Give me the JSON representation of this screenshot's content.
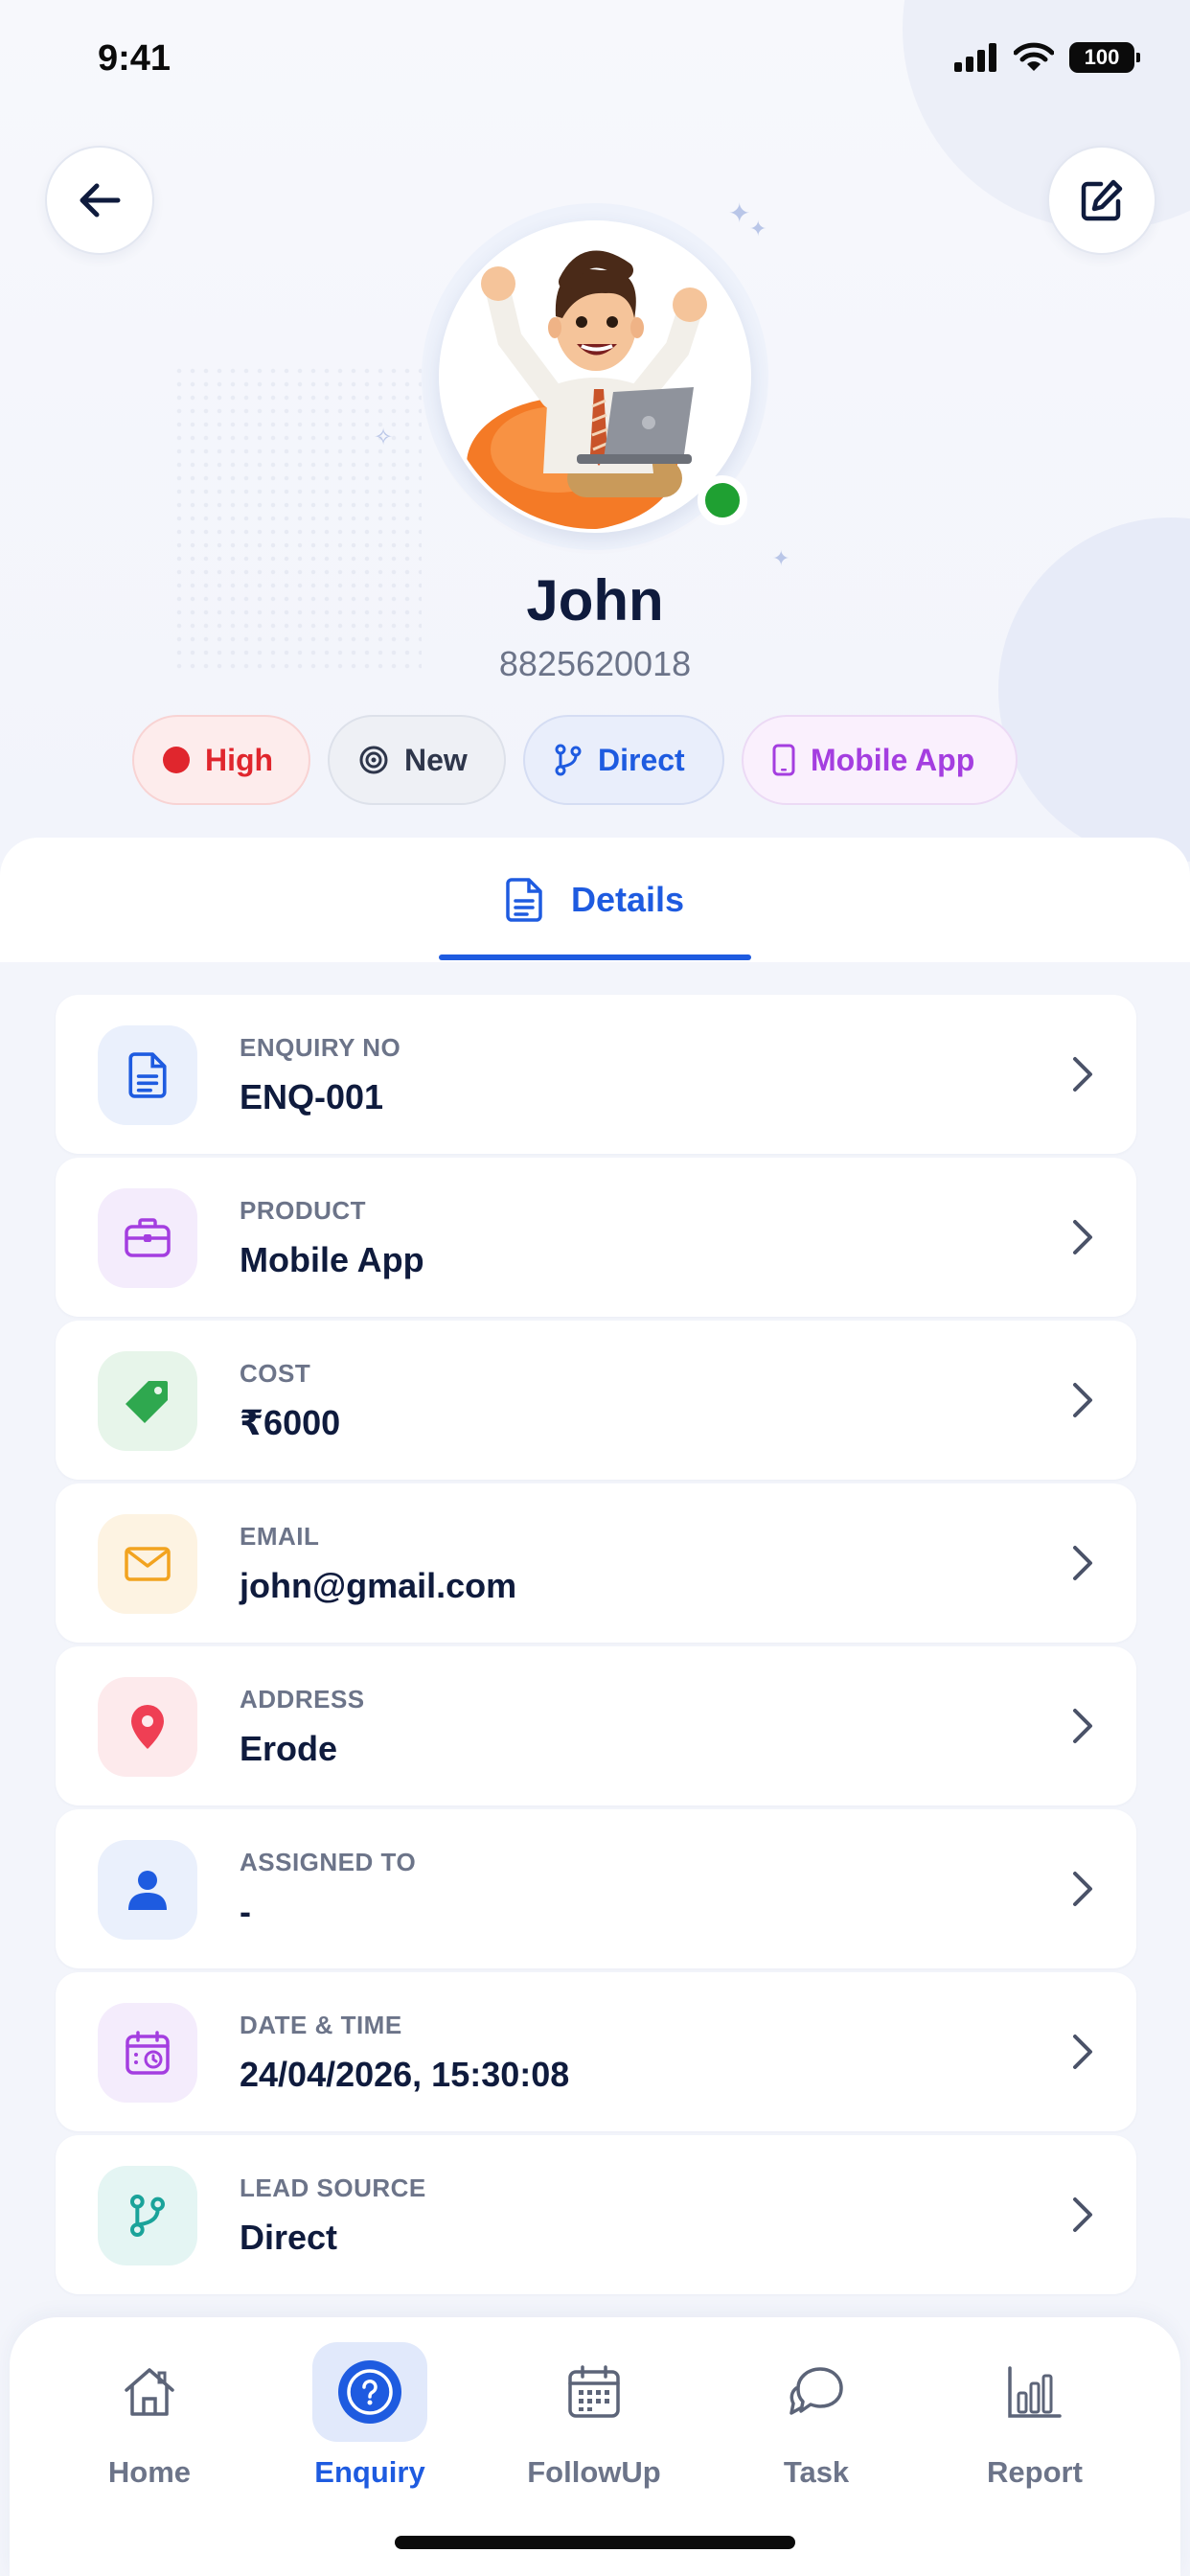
{
  "status_bar": {
    "time": "9:41",
    "battery": "100"
  },
  "profile": {
    "name": "John",
    "phone": "8825620018",
    "online": true
  },
  "chips": [
    {
      "label": "High",
      "icon": "red-dot-icon",
      "color": "#e0262d"
    },
    {
      "label": "New",
      "icon": "target-icon",
      "color": "#2e364b"
    },
    {
      "label": "Direct",
      "icon": "branch-icon",
      "color": "#1e5be0"
    },
    {
      "label": "Mobile App",
      "icon": "phone-icon",
      "color": "#a43ee0"
    }
  ],
  "tabs": {
    "details": "Details"
  },
  "details": [
    {
      "label": "ENQUIRY NO",
      "value": "ENQ-001",
      "icon": "document-icon"
    },
    {
      "label": "PRODUCT",
      "value": "Mobile App",
      "icon": "briefcase-icon"
    },
    {
      "label": "COST",
      "value": "₹6000",
      "icon": "price-tag-icon"
    },
    {
      "label": "EMAIL",
      "value": "john@gmail.com",
      "icon": "mail-icon"
    },
    {
      "label": "ADDRESS",
      "value": "Erode",
      "icon": "location-pin-icon"
    },
    {
      "label": "ASSIGNED TO",
      "value": "-",
      "icon": "user-icon"
    },
    {
      "label": "DATE & TIME",
      "value": "24/04/2026, 15:30:08",
      "icon": "calendar-clock-icon"
    },
    {
      "label": "LEAD SOURCE",
      "value": "Direct",
      "icon": "branch-icon"
    }
  ],
  "nav": [
    {
      "label": "Home",
      "icon": "home-icon",
      "active": false
    },
    {
      "label": "Enquiry",
      "icon": "question-icon",
      "active": true
    },
    {
      "label": "FollowUp",
      "icon": "calendar-icon",
      "active": false
    },
    {
      "label": "Task",
      "icon": "chat-bubble-icon",
      "active": false
    },
    {
      "label": "Report",
      "icon": "bar-chart-icon",
      "active": false
    }
  ],
  "colors": {
    "accent": "#1e5be0",
    "text_primary": "#0f1b3d",
    "text_secondary": "#6c7489",
    "online": "#1fa032"
  }
}
